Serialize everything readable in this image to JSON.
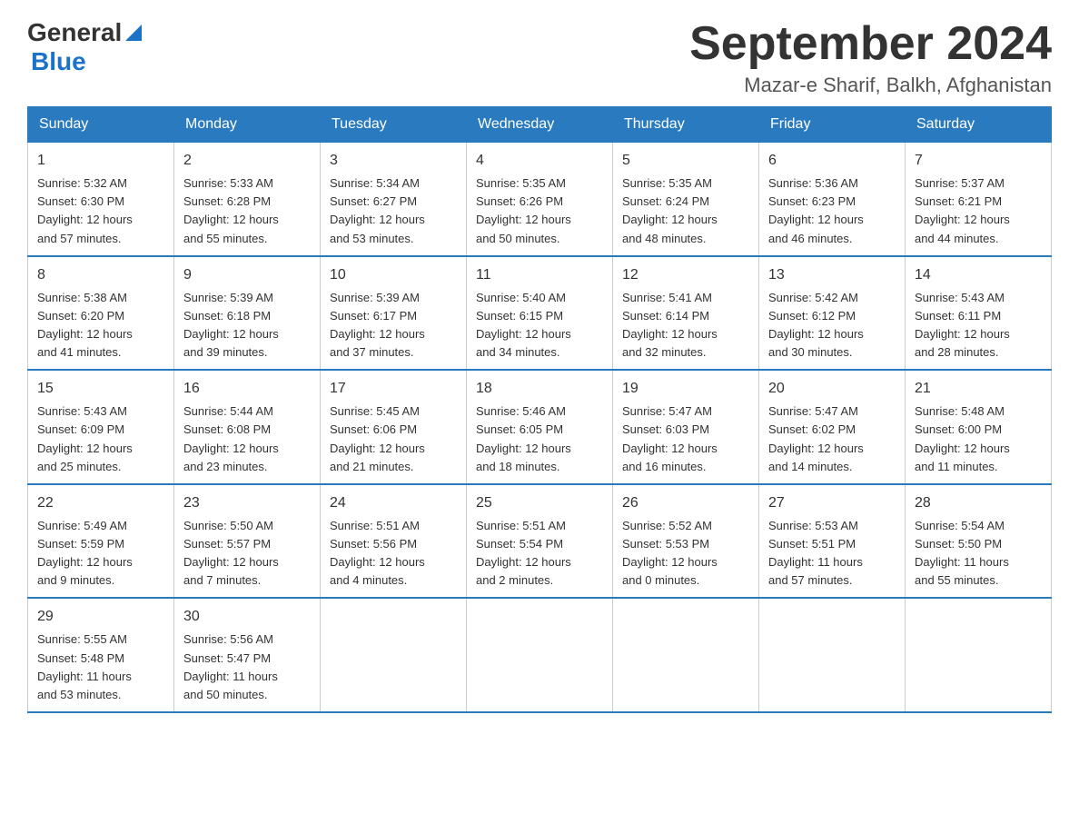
{
  "logo": {
    "general": "General",
    "blue": "Blue"
  },
  "title": "September 2024",
  "location": "Mazar-e Sharif, Balkh, Afghanistan",
  "headers": [
    "Sunday",
    "Monday",
    "Tuesday",
    "Wednesday",
    "Thursday",
    "Friday",
    "Saturday"
  ],
  "weeks": [
    [
      {
        "day": "1",
        "info": "Sunrise: 5:32 AM\nSunset: 6:30 PM\nDaylight: 12 hours\nand 57 minutes."
      },
      {
        "day": "2",
        "info": "Sunrise: 5:33 AM\nSunset: 6:28 PM\nDaylight: 12 hours\nand 55 minutes."
      },
      {
        "day": "3",
        "info": "Sunrise: 5:34 AM\nSunset: 6:27 PM\nDaylight: 12 hours\nand 53 minutes."
      },
      {
        "day": "4",
        "info": "Sunrise: 5:35 AM\nSunset: 6:26 PM\nDaylight: 12 hours\nand 50 minutes."
      },
      {
        "day": "5",
        "info": "Sunrise: 5:35 AM\nSunset: 6:24 PM\nDaylight: 12 hours\nand 48 minutes."
      },
      {
        "day": "6",
        "info": "Sunrise: 5:36 AM\nSunset: 6:23 PM\nDaylight: 12 hours\nand 46 minutes."
      },
      {
        "day": "7",
        "info": "Sunrise: 5:37 AM\nSunset: 6:21 PM\nDaylight: 12 hours\nand 44 minutes."
      }
    ],
    [
      {
        "day": "8",
        "info": "Sunrise: 5:38 AM\nSunset: 6:20 PM\nDaylight: 12 hours\nand 41 minutes."
      },
      {
        "day": "9",
        "info": "Sunrise: 5:39 AM\nSunset: 6:18 PM\nDaylight: 12 hours\nand 39 minutes."
      },
      {
        "day": "10",
        "info": "Sunrise: 5:39 AM\nSunset: 6:17 PM\nDaylight: 12 hours\nand 37 minutes."
      },
      {
        "day": "11",
        "info": "Sunrise: 5:40 AM\nSunset: 6:15 PM\nDaylight: 12 hours\nand 34 minutes."
      },
      {
        "day": "12",
        "info": "Sunrise: 5:41 AM\nSunset: 6:14 PM\nDaylight: 12 hours\nand 32 minutes."
      },
      {
        "day": "13",
        "info": "Sunrise: 5:42 AM\nSunset: 6:12 PM\nDaylight: 12 hours\nand 30 minutes."
      },
      {
        "day": "14",
        "info": "Sunrise: 5:43 AM\nSunset: 6:11 PM\nDaylight: 12 hours\nand 28 minutes."
      }
    ],
    [
      {
        "day": "15",
        "info": "Sunrise: 5:43 AM\nSunset: 6:09 PM\nDaylight: 12 hours\nand 25 minutes."
      },
      {
        "day": "16",
        "info": "Sunrise: 5:44 AM\nSunset: 6:08 PM\nDaylight: 12 hours\nand 23 minutes."
      },
      {
        "day": "17",
        "info": "Sunrise: 5:45 AM\nSunset: 6:06 PM\nDaylight: 12 hours\nand 21 minutes."
      },
      {
        "day": "18",
        "info": "Sunrise: 5:46 AM\nSunset: 6:05 PM\nDaylight: 12 hours\nand 18 minutes."
      },
      {
        "day": "19",
        "info": "Sunrise: 5:47 AM\nSunset: 6:03 PM\nDaylight: 12 hours\nand 16 minutes."
      },
      {
        "day": "20",
        "info": "Sunrise: 5:47 AM\nSunset: 6:02 PM\nDaylight: 12 hours\nand 14 minutes."
      },
      {
        "day": "21",
        "info": "Sunrise: 5:48 AM\nSunset: 6:00 PM\nDaylight: 12 hours\nand 11 minutes."
      }
    ],
    [
      {
        "day": "22",
        "info": "Sunrise: 5:49 AM\nSunset: 5:59 PM\nDaylight: 12 hours\nand 9 minutes."
      },
      {
        "day": "23",
        "info": "Sunrise: 5:50 AM\nSunset: 5:57 PM\nDaylight: 12 hours\nand 7 minutes."
      },
      {
        "day": "24",
        "info": "Sunrise: 5:51 AM\nSunset: 5:56 PM\nDaylight: 12 hours\nand 4 minutes."
      },
      {
        "day": "25",
        "info": "Sunrise: 5:51 AM\nSunset: 5:54 PM\nDaylight: 12 hours\nand 2 minutes."
      },
      {
        "day": "26",
        "info": "Sunrise: 5:52 AM\nSunset: 5:53 PM\nDaylight: 12 hours\nand 0 minutes."
      },
      {
        "day": "27",
        "info": "Sunrise: 5:53 AM\nSunset: 5:51 PM\nDaylight: 11 hours\nand 57 minutes."
      },
      {
        "day": "28",
        "info": "Sunrise: 5:54 AM\nSunset: 5:50 PM\nDaylight: 11 hours\nand 55 minutes."
      }
    ],
    [
      {
        "day": "29",
        "info": "Sunrise: 5:55 AM\nSunset: 5:48 PM\nDaylight: 11 hours\nand 53 minutes."
      },
      {
        "day": "30",
        "info": "Sunrise: 5:56 AM\nSunset: 5:47 PM\nDaylight: 11 hours\nand 50 minutes."
      },
      {
        "day": "",
        "info": ""
      },
      {
        "day": "",
        "info": ""
      },
      {
        "day": "",
        "info": ""
      },
      {
        "day": "",
        "info": ""
      },
      {
        "day": "",
        "info": ""
      }
    ]
  ]
}
